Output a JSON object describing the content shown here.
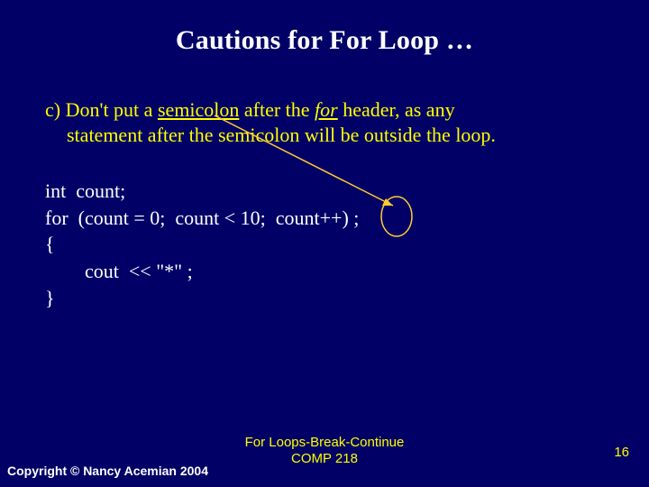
{
  "title": "Cautions  for For Loop …",
  "caution": {
    "prefix": "c) Don't put a ",
    "semicolon_word": "semicolon",
    "mid1": " after the ",
    "for_word": "for",
    "suffix1": " header, as any",
    "line2": "statement after the semicolon will be outside the loop."
  },
  "code": {
    "l1": "int  count;",
    "l2": "for  (count = 0;  count < 10;  count++) ;",
    "l3": "{",
    "l4": "        cout  << \"*\" ;",
    "l5": "}"
  },
  "footer": {
    "copyright": "Copyright  © Nancy Acemian 2004",
    "center_l1": "For Loops-Break-Continue",
    "center_l2": "COMP 218",
    "page": "16"
  },
  "colors": {
    "bg": "#000066",
    "heading": "#ffffff",
    "body": "#ffff00",
    "code": "#ffffff",
    "callout_stroke": "#ffcc33"
  }
}
